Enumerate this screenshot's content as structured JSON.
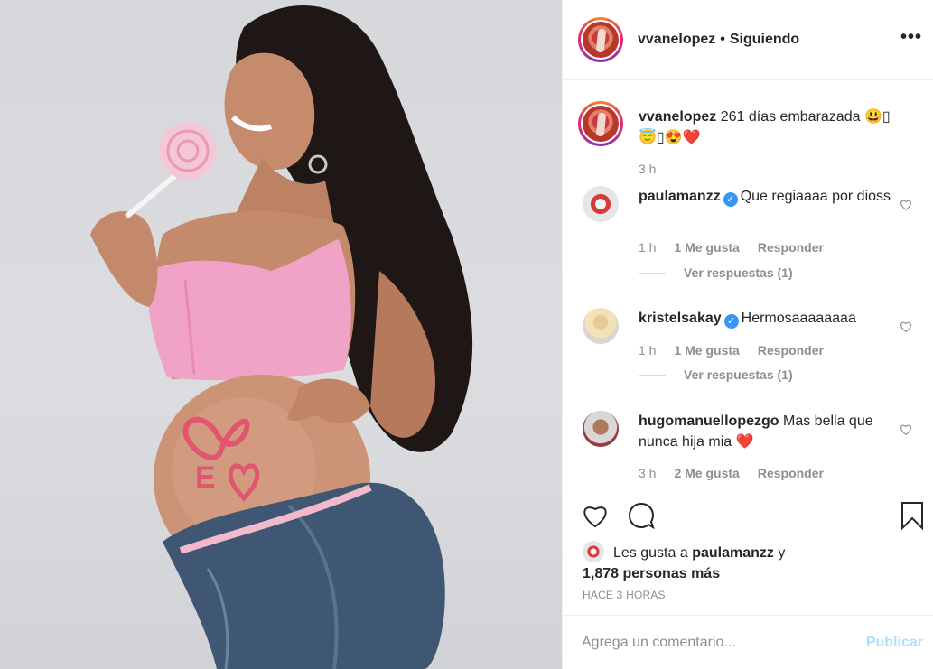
{
  "post": {
    "username": "vvanelopez",
    "follow_state": "Siguiendo",
    "separator": "•",
    "more_glyph": "•••"
  },
  "caption": {
    "username": "vvanelopez",
    "text_line1": "261 días embarazada 😃▯",
    "text_line2": "😇▯😍❤️",
    "time": "3 h"
  },
  "comments": [
    {
      "username": "paulamanzz",
      "verified": true,
      "text": "Que regiaaaa por dioss",
      "time": "1 h",
      "likes": "1 Me gusta",
      "reply": "Responder",
      "view_replies": "Ver respuestas (1)"
    },
    {
      "username": "kristelsakay",
      "verified": true,
      "text": "Hermosaaaaaaaa",
      "time": "1 h",
      "likes": "1 Me gusta",
      "reply": "Responder",
      "view_replies": "Ver respuestas (1)"
    },
    {
      "username": "hugomanuellopezgo",
      "verified": false,
      "text": "Mas bella que nunca hija mia ❤️",
      "time": "3 h",
      "likes": "2 Me gusta",
      "reply": "Responder"
    }
  ],
  "likes_summary": {
    "prefix": "Les gusta a",
    "user": "paulamanzz",
    "conj": "y",
    "others": "1,878 personas más"
  },
  "timestamp": "HACE 3 HORAS",
  "composer": {
    "placeholder": "Agrega un comentario...",
    "post_label": "Publicar"
  },
  "colors": {
    "text": "#262626",
    "muted": "#8e8e8e",
    "verified": "#3897f0",
    "post_disabled": "#b2dffc",
    "border": "#efefef"
  },
  "icons": [
    "heart-icon",
    "comment-icon",
    "bookmark-icon",
    "more-options-icon",
    "verified-badge-icon"
  ]
}
